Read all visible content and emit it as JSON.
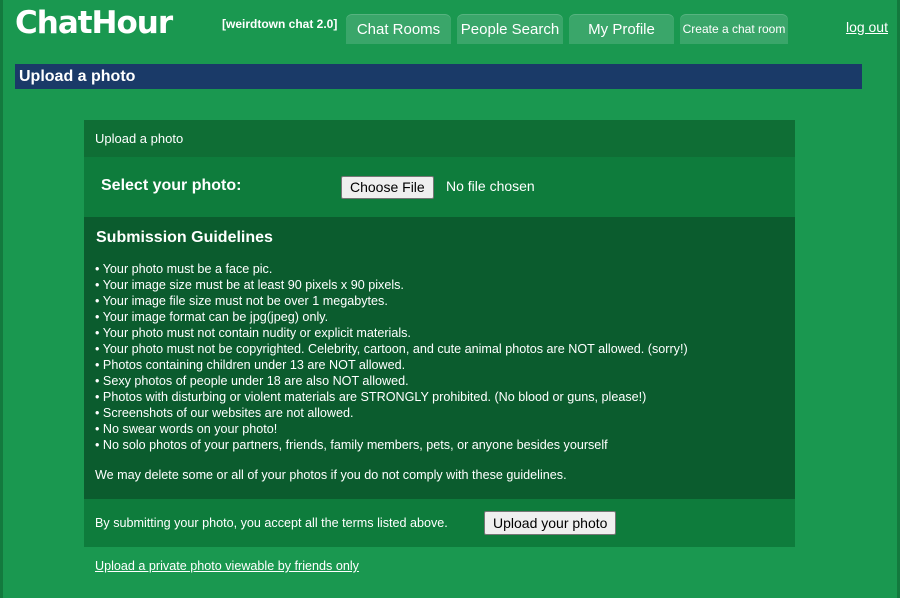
{
  "header": {
    "logo_text": "ChatHour",
    "site_tag": "[weirdtown chat 2.0]",
    "tabs": [
      "Chat Rooms",
      "People Search",
      "My Profile",
      "Create a chat room"
    ],
    "logout_label": "log out"
  },
  "page_title": "Upload a photo",
  "panel": {
    "head": "Upload a photo",
    "select_label": "Select your photo:",
    "file_button_label": "Choose File",
    "file_status": "No file chosen",
    "guidelines_title": "Submission Guidelines",
    "guidelines": [
      "Your photo must be a face pic.",
      "Your image size must be at least 90 pixels x 90 pixels.",
      "Your image file size must not be over 1 megabytes.",
      "Your image format can be jpg(jpeg) only.",
      "Your photo must not contain nudity or explicit materials.",
      "Your photo must not be copyrighted. Celebrity, cartoon, and cute animal photos are NOT allowed. (sorry!)",
      "Photos containing children under 13 are NOT allowed.",
      "Sexy photos of people under 18 are also NOT allowed.",
      "Photos with disturbing or violent materials are STRONGLY prohibited. (No blood or guns, please!)",
      "Screenshots of our websites are not allowed.",
      "No swear words on your photo!",
      "No solo photos of your partners, friends, family members, pets, or anyone besides yourself"
    ],
    "warning": "We may delete some or all of your photos if you do not comply with these guidelines.",
    "submit_text": "By submitting your photo, you accept all the terms listed above.",
    "submit_button_label": "Upload your photo"
  },
  "private_link_label": "Upload a private photo viewable by friends only"
}
